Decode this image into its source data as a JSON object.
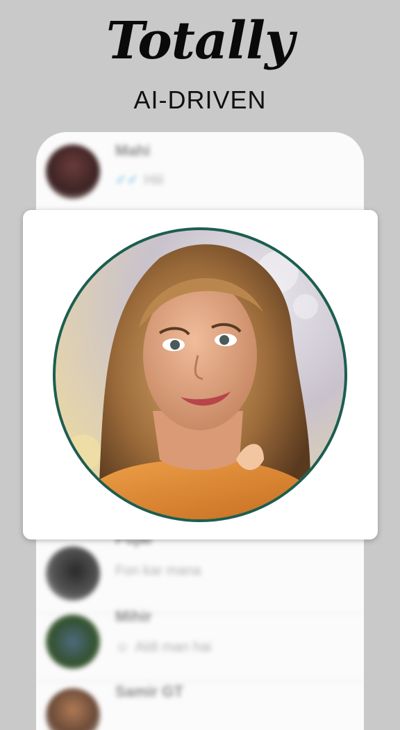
{
  "headline": {
    "script": "Totally",
    "subtitle": "AI-DRIVEN"
  },
  "chats": [
    {
      "name": "Mahi",
      "preview": "Hiii",
      "status_icon": "double-check-icon"
    },
    {
      "name": "Pujai",
      "preview": "Fon kar mana"
    },
    {
      "name": "Mihir",
      "preview": "Aldi man hai",
      "status_icon": "person-icon"
    },
    {
      "name": "Samir GT",
      "preview": ""
    }
  ],
  "colors": {
    "accent_ring": "#1c5e50",
    "tick": "#4fb3e8",
    "background": "#c9c9c9"
  }
}
